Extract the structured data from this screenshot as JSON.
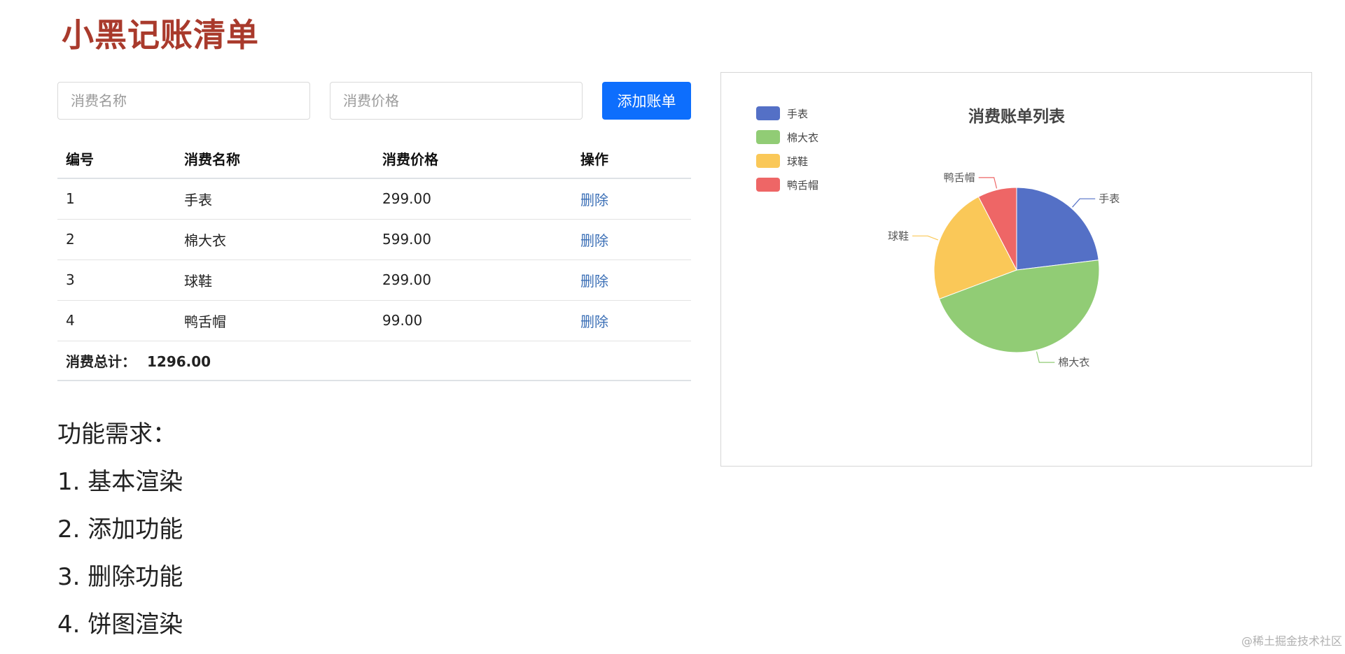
{
  "page": {
    "title": "小黑记账清单"
  },
  "form": {
    "name_placeholder": "消费名称",
    "price_placeholder": "消费价格",
    "add_label": "添加账单"
  },
  "table": {
    "headers": [
      "编号",
      "消费名称",
      "消费价格",
      "操作"
    ],
    "rows": [
      {
        "id": "1",
        "name": "手表",
        "price": "299.00",
        "action": "删除"
      },
      {
        "id": "2",
        "name": "棉大衣",
        "price": "599.00",
        "action": "删除"
      },
      {
        "id": "3",
        "name": "球鞋",
        "price": "299.00",
        "action": "删除"
      },
      {
        "id": "4",
        "name": "鸭舌帽",
        "price": "99.00",
        "action": "删除"
      }
    ],
    "total_label": "消费总计：",
    "total_value": "1296.00"
  },
  "requirements": {
    "title": "功能需求：",
    "items": [
      "1. 基本渲染",
      "2. 添加功能",
      "3. 删除功能",
      "4. 饼图渲染"
    ]
  },
  "chart_data": {
    "type": "pie",
    "title": "消费账单列表",
    "categories": [
      "手表",
      "棉大衣",
      "球鞋",
      "鸭舌帽"
    ],
    "values": [
      299,
      599,
      299,
      99
    ],
    "colors": [
      "#5470c6",
      "#91cc75",
      "#fac858",
      "#ee6666"
    ],
    "legend_position": "top-left"
  },
  "watermark": "@稀土掘金技术社区"
}
